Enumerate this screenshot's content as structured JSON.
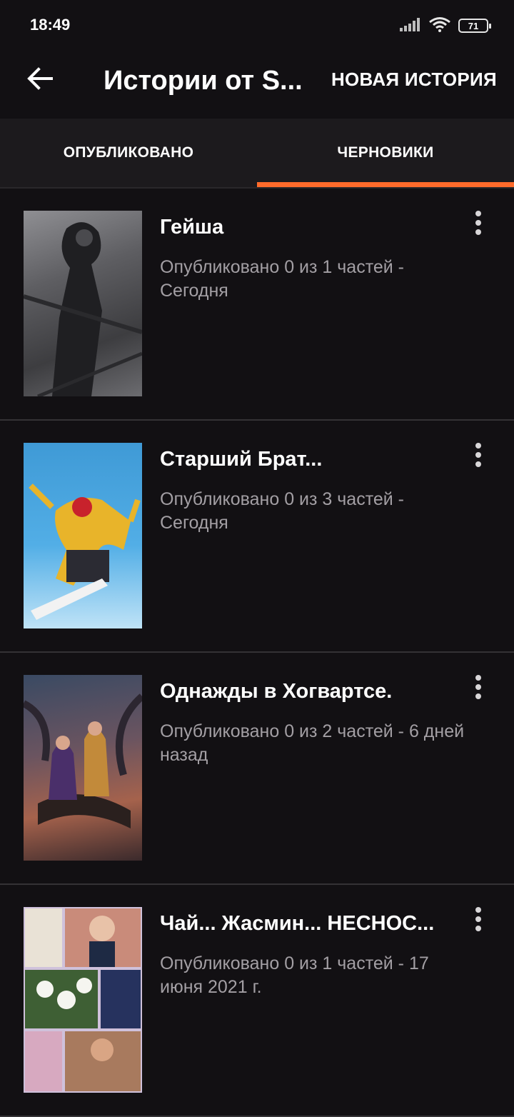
{
  "status_bar": {
    "time": "18:49",
    "battery": "71"
  },
  "app_bar": {
    "title": "Истории от S...",
    "new_story": "НОВАЯ ИСТОРИЯ"
  },
  "tabs": [
    {
      "label": "ОПУБЛИКОВАНО",
      "active": false
    },
    {
      "label": "ЧЕРНОВИКИ",
      "active": true
    }
  ],
  "accent_color": "#ff6b2b",
  "stories": [
    {
      "title": "Гейша",
      "meta": "Опубликовано 0 из 1 частей - Сегодня"
    },
    {
      "title": "Старший Брат...",
      "meta": "Опубликовано 0 из 3 частей - Сегодня"
    },
    {
      "title": "Однажды в Хогвартсе.",
      "meta": "Опубликовано 0 из 2 частей - 6 дней назад"
    },
    {
      "title": "Чай... Жасмин... НЕСНОС...",
      "meta": "Опубликовано 0 из 1 частей - 17 июня 2021 г."
    }
  ]
}
